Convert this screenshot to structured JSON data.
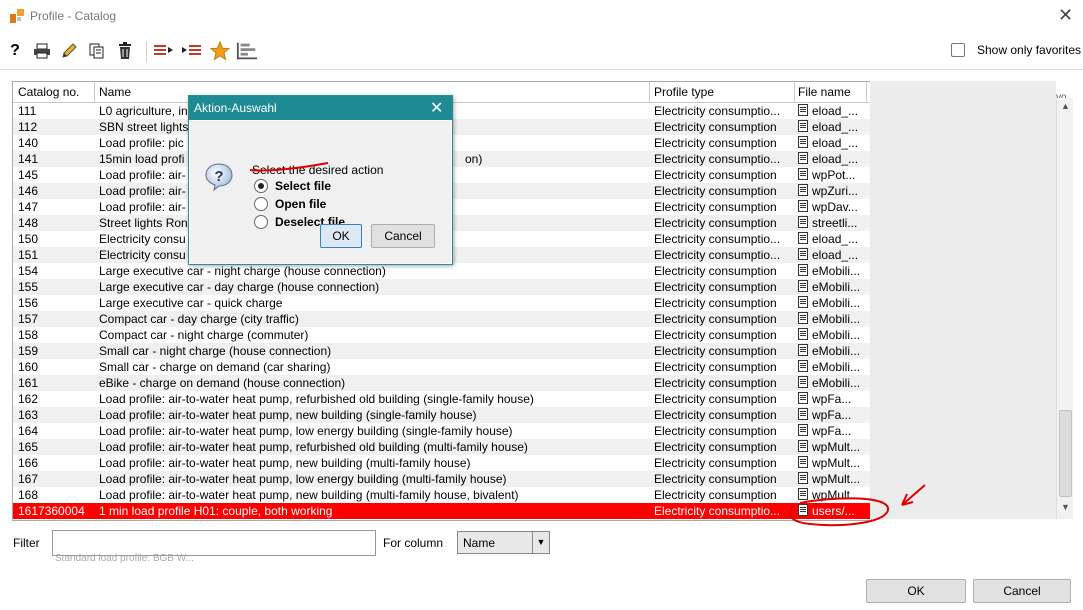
{
  "window": {
    "title": "Profile - Catalog"
  },
  "toolbar": {
    "show_only_favorites_label": "Show only favorites",
    "show_only_favorites_checked": false
  },
  "table": {
    "columns": [
      "Catalog no.",
      "Name",
      "Profile type",
      "File name"
    ],
    "rows": [
      {
        "no": "111",
        "name": "L0 agriculture, in",
        "type": "Electricity consumptio...",
        "file": "eload_..."
      },
      {
        "no": "112",
        "name": "SBN street lights",
        "type": "Electricity consumption",
        "file": "eload_..."
      },
      {
        "no": "140",
        "name": "Load profile: pic",
        "type": "Electricity consumption",
        "file": "eload_..."
      },
      {
        "no": "141",
        "name": "15min load profi",
        "name_tail": "on)",
        "type": "Electricity consumptio...",
        "file": "eload_..."
      },
      {
        "no": "145",
        "name": "Load profile: air-",
        "type": "Electricity consumption",
        "file": "wpPot..."
      },
      {
        "no": "146",
        "name": "Load profile: air-",
        "type": "Electricity consumption",
        "file": "wpZuri..."
      },
      {
        "no": "147",
        "name": "Load profile: air-",
        "type": "Electricity consumption",
        "file": "wpDav..."
      },
      {
        "no": "148",
        "name": "Street lights Ron",
        "type": "Electricity consumption",
        "file": "streetli..."
      },
      {
        "no": "150",
        "name": "Electricity consu",
        "type": "Electricity consumptio...",
        "file": "eload_..."
      },
      {
        "no": "151",
        "name": "Electricity consu",
        "type": "Electricity consumptio...",
        "file": "eload_..."
      },
      {
        "no": "154",
        "name": "Large executive car - night charge (house connection)",
        "type": "Electricity consumption",
        "file": "eMobili..."
      },
      {
        "no": "155",
        "name": "Large executive car - day charge (house connection)",
        "type": "Electricity consumption",
        "file": "eMobili..."
      },
      {
        "no": "156",
        "name": "Large executive car - quick charge",
        "type": "Electricity consumption",
        "file": "eMobili..."
      },
      {
        "no": "157",
        "name": "Compact car - day charge (city traffic)",
        "type": "Electricity consumption",
        "file": "eMobili..."
      },
      {
        "no": "158",
        "name": "Compact car - night charge (commuter)",
        "type": "Electricity consumption",
        "file": "eMobili..."
      },
      {
        "no": "159",
        "name": "Small car - night charge (house connection)",
        "type": "Electricity consumption",
        "file": "eMobili..."
      },
      {
        "no": "160",
        "name": "Small car - charge on demand (car sharing)",
        "type": "Electricity consumption",
        "file": "eMobili..."
      },
      {
        "no": "161",
        "name": "eBike - charge on demand (house connection)",
        "type": "Electricity consumption",
        "file": "eMobili..."
      },
      {
        "no": "162",
        "name": "Load profile: air-to-water heat pump, refurbished old building (single-family house)",
        "type": "Electricity consumption",
        "file": "wpFa..."
      },
      {
        "no": "163",
        "name": "Load profile: air-to-water heat pump, new building (single-family house)",
        "type": "Electricity consumption",
        "file": "wpFa..."
      },
      {
        "no": "164",
        "name": "Load profile: air-to-water heat pump, low energy building (single-family house)",
        "type": "Electricity consumption",
        "file": "wpFa..."
      },
      {
        "no": "165",
        "name": "Load profile: air-to-water heat pump, refurbished old building (multi-family house)",
        "type": "Electricity consumption",
        "file": "wpMult..."
      },
      {
        "no": "166",
        "name": "Load profile: air-to-water heat pump, new building (multi-family house)",
        "type": "Electricity consumption",
        "file": "wpMult..."
      },
      {
        "no": "167",
        "name": "Load profile: air-to-water heat pump, low energy building (multi-family house)",
        "type": "Electricity consumption",
        "file": "wpMult..."
      },
      {
        "no": "168",
        "name": "Load profile: air-to-water heat pump, new building (multi-family house, bivalent)",
        "type": "Electricity consumption",
        "file": "wpMult..."
      },
      {
        "no": "1617360004",
        "name": "1 min load profile H01: couple, both working",
        "type": "Electricity consumptio...",
        "file": "users/...",
        "selected": true
      }
    ],
    "right_cut_text": "vo"
  },
  "filter": {
    "label": "Filter",
    "value": "",
    "for_column_label": "For column",
    "column_selected": "Name",
    "ghost_text": "Standard load profile: BGB W..."
  },
  "buttons": {
    "ok": "OK",
    "cancel": "Cancel"
  },
  "dialog": {
    "title": "Aktion-Auswahl",
    "prompt": "Select the desired action",
    "options": [
      {
        "label": "Select file",
        "selected": true
      },
      {
        "label": "Open file",
        "selected": false
      },
      {
        "label": "Deselect file",
        "selected": false
      }
    ],
    "ok": "OK",
    "cancel": "Cancel"
  },
  "colors": {
    "selection": "#ff0000",
    "dialog_title": "#1e8a93",
    "annotation": "#e00000"
  }
}
